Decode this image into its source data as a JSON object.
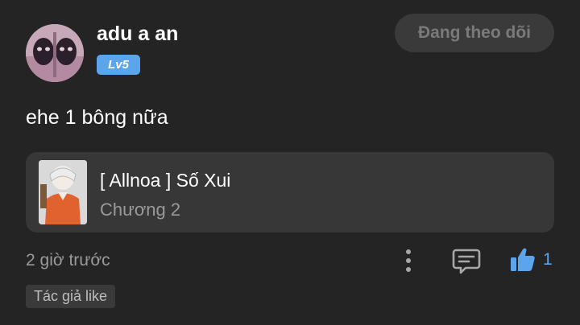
{
  "user": {
    "name": "adu a an",
    "level": "Lv5"
  },
  "follow_button": {
    "label": "Đang theo dõi"
  },
  "comment": {
    "text": "ehe 1 bông nữa"
  },
  "chapter_card": {
    "title": "[ Allnoa ] Số Xui",
    "chapter": "Chương 2"
  },
  "footer": {
    "timestamp": "2 giờ trước",
    "like_count": "1",
    "author_badge": "Tác giả like"
  },
  "icons": {
    "more": "more-vertical-icon",
    "reply": "comment-bubble-icon",
    "like": "thumbs-up-icon"
  },
  "colors": {
    "background": "#242424",
    "accent": "#5aa5ec",
    "card": "#373737",
    "muted_text": "#9a9a9a"
  }
}
